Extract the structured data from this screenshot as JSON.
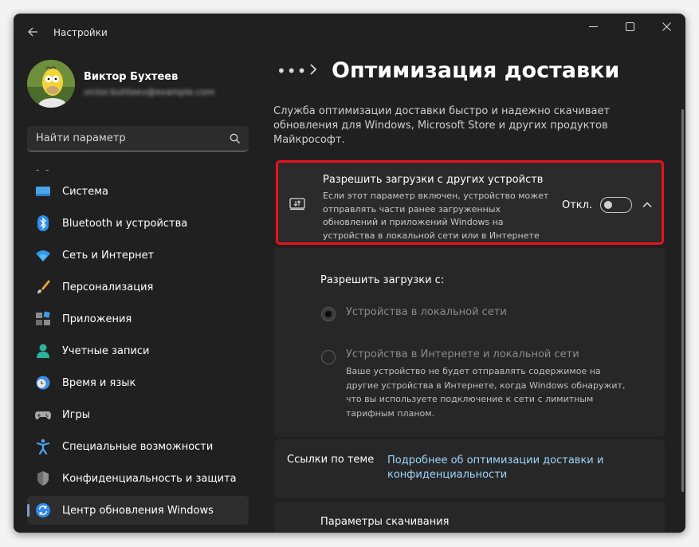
{
  "window": {
    "title": "Настройки"
  },
  "user": {
    "name": "Виктор Бухтеев",
    "email": "victor.buhteev@example.com"
  },
  "search": {
    "placeholder": "Найти параметр"
  },
  "nav": {
    "items": [
      {
        "label": "Система",
        "icon": "monitor-icon"
      },
      {
        "label": "Bluetooth и устройства",
        "icon": "bluetooth-icon"
      },
      {
        "label": "Сеть и Интернет",
        "icon": "wifi-icon"
      },
      {
        "label": "Персонализация",
        "icon": "brush-icon"
      },
      {
        "label": "Приложения",
        "icon": "apps-icon"
      },
      {
        "label": "Учетные записи",
        "icon": "person-icon"
      },
      {
        "label": "Время и язык",
        "icon": "clock-globe-icon"
      },
      {
        "label": "Игры",
        "icon": "gamepad-icon"
      },
      {
        "label": "Специальные возможности",
        "icon": "accessibility-icon"
      },
      {
        "label": "Конфиденциальность и защита",
        "icon": "shield-icon"
      },
      {
        "label": "Центр обновления Windows",
        "icon": "update-icon",
        "active": true
      }
    ]
  },
  "page": {
    "breadcrumb_more": "•••",
    "title": "Оптимизация доставки",
    "description": "Служба оптимизации доставки быстро и надежно скачивает обновления для Windows, Microsoft Store и других продуктов Майкрософт."
  },
  "allow_downloads": {
    "title": "Разрешить загрузки с других устройств",
    "description": "Если этот параметр включен, устройство может отправлять части ранее загруженных обновлений и приложений Windows на устройства в локальной сети или в Интернете",
    "toggle_label": "Откл.",
    "toggle_on": false,
    "expanded": true,
    "sub_label": "Разрешить загрузки с:",
    "options": [
      {
        "label": "Устройства в локальной сети",
        "selected": true,
        "disabled": true
      },
      {
        "label": "Устройства в Интернете и локальной сети",
        "selected": false,
        "disabled": true,
        "description": "Ваше устройство не будет отправлять содержимое на другие устройства в Интернете, когда Windows обнаружит, что вы используете подключение к сети с лимитным тарифным планом."
      }
    ]
  },
  "related": {
    "label": "Ссылки по теме",
    "link": "Подробнее об оптимизации доставки и конфиденциальности"
  },
  "download_params": {
    "label": "Параметры скачивания"
  },
  "colors": {
    "accent": "#7a9fd6",
    "highlight_border": "#e8121c",
    "link": "#9fd6ff"
  }
}
